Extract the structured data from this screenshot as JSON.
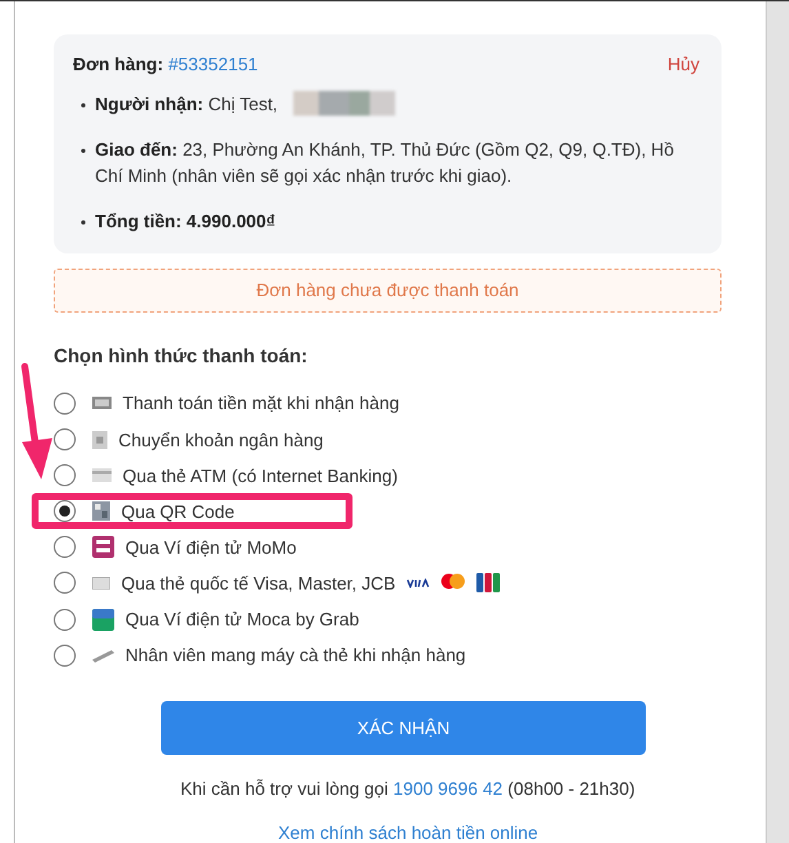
{
  "order": {
    "label": "Đơn hàng:",
    "number": "#53352151",
    "cancel": "Hủy",
    "details": [
      {
        "kind": "recipient",
        "label": "Người nhận:",
        "value": "Chị Test,",
        "redacted": true
      },
      {
        "kind": "address",
        "label": "Giao đến:",
        "value": "23, Phường An Khánh, TP. Thủ Đức (Gồm Q2, Q9, Q.TĐ), Hồ Chí Minh (nhân viên sẽ gọi xác nhận trước khi giao).",
        "redacted": false
      },
      {
        "kind": "total",
        "label": "Tổng tiền: 4.990.000₫",
        "redacted": false
      }
    ]
  },
  "payment_status": "Đơn hàng chưa được thanh toán",
  "payment_heading": "Chọn hình thức thanh toán:",
  "payment_methods": [
    {
      "kind": "cash",
      "label": "Thanh toán tiền mặt khi nhận hàng",
      "selected": false,
      "highlighted": false
    },
    {
      "kind": "bank",
      "label": "Chuyển khoản ngân hàng",
      "selected": false,
      "highlighted": false
    },
    {
      "kind": "atm",
      "label": "Qua thẻ ATM (có Internet Banking)",
      "selected": false,
      "highlighted": false
    },
    {
      "kind": "qr",
      "label": "Qua QR Code",
      "selected": true,
      "highlighted": true
    },
    {
      "kind": "momo",
      "label": "Qua Ví điện tử MoMo",
      "selected": false,
      "highlighted": false
    },
    {
      "kind": "card",
      "label": "Qua thẻ quốc tế Visa, Master, JCB",
      "selected": false,
      "highlighted": false
    },
    {
      "kind": "moca",
      "label": "Qua Ví điện tử Moca by Grab",
      "selected": false,
      "highlighted": false
    },
    {
      "kind": "pos",
      "label": "Nhân viên mang máy cà thẻ khi nhận hàng",
      "selected": false,
      "highlighted": false
    }
  ],
  "confirm_button": "XÁC NHẬN",
  "support": {
    "text": "Khi cần hỗ trợ vui lòng gọi",
    "phone": "1900 9696 42",
    "hours": "(08h00 - 21h30)"
  },
  "refund_link": "Xem chính sách hoàn tiền online"
}
